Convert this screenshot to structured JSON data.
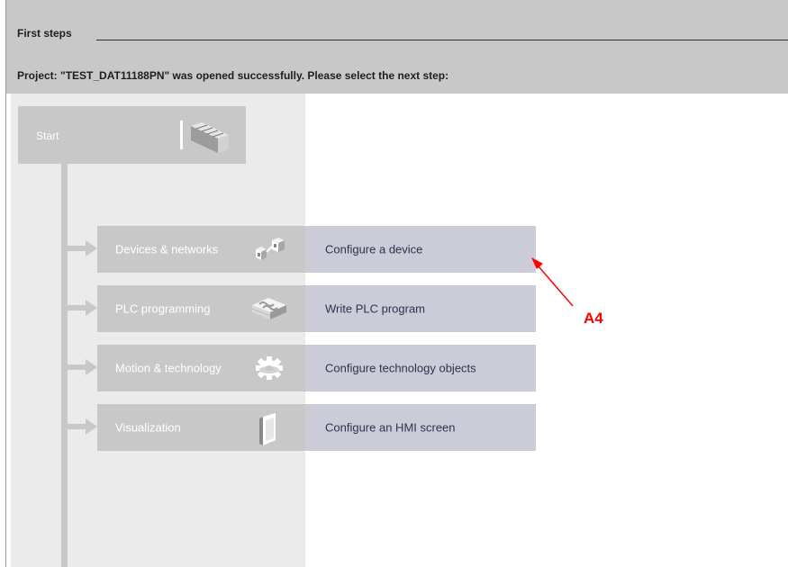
{
  "header": {
    "section_title": "First steps",
    "project_message": "Project: \"TEST_DAT11188PN\" was opened successfully. Please select the next step:"
  },
  "start": {
    "label": "Start",
    "icon": "stairs-icon"
  },
  "steps": [
    {
      "label": "Devices & networks",
      "icon": "devices-networks-icon",
      "action": "Configure a device"
    },
    {
      "label": "PLC programming",
      "icon": "plc-programming-icon",
      "action": "Write PLC program"
    },
    {
      "label": "Motion & technology",
      "icon": "motion-gear-icon",
      "action": "Configure technology objects"
    },
    {
      "label": "Visualization",
      "icon": "hmi-screen-icon",
      "action": "Configure an HMI screen"
    }
  ],
  "annotation": {
    "label": "A4",
    "color": "#ff0000"
  },
  "colors": {
    "header_band": "#c8c8c8",
    "left_panel": "#ebebeb",
    "step_left": "#c8c8c8",
    "step_right": "#ccccd9",
    "action_text": "#303050"
  }
}
